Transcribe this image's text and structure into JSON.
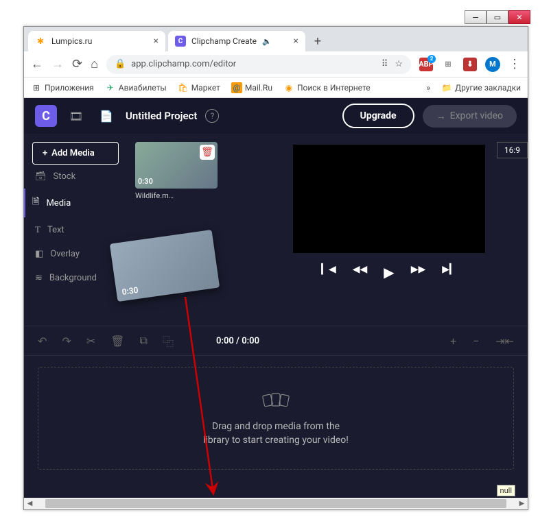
{
  "window": {
    "tabs": [
      {
        "favicon_color": "#f90",
        "label": "Lumpics.ru"
      },
      {
        "favicon_bg": "#6c5ce7",
        "favicon_text": "C",
        "label": "Clipchamp Create",
        "sound": "🔈"
      }
    ],
    "url_display": "app.clipchamp.com/editor"
  },
  "bookmarks": {
    "apps": "Приложения",
    "items": [
      {
        "icon": "✈",
        "label": "Авиабилеты",
        "color": "#3a7"
      },
      {
        "icon": "🛒",
        "label": "Маркет",
        "color": "#f90"
      },
      {
        "icon": "@",
        "label": "Mail.Ru",
        "color": "#f90",
        "bg": "#16a"
      },
      {
        "icon": "⊙",
        "label": "Поиск в Интернете",
        "color": "#f90"
      }
    ],
    "more": "»",
    "other": "Другие закладки"
  },
  "header": {
    "logo": "C",
    "project": "Untitled Project",
    "upgrade": "Upgrade",
    "export": "Export video"
  },
  "sidebar": {
    "add": "Add Media",
    "items": [
      {
        "icon": "🗂",
        "label": "Stock"
      },
      {
        "icon": "📄",
        "label": "Media"
      },
      {
        "icon": "T",
        "label": "Text"
      },
      {
        "icon": "▢",
        "label": "Overlay"
      },
      {
        "icon": "≡",
        "label": "Background"
      }
    ]
  },
  "media": {
    "thumb": {
      "duration": "0:30",
      "name": "Wildlife.m…"
    },
    "dragging": {
      "duration": "0:30"
    }
  },
  "preview": {
    "aspect": "16:9"
  },
  "timeline": {
    "time": "0:00 / 0:00"
  },
  "dropzone": {
    "line1": "Drag and drop media from the",
    "line2": "library to start creating your video!"
  },
  "misc": {
    "null": "null"
  }
}
